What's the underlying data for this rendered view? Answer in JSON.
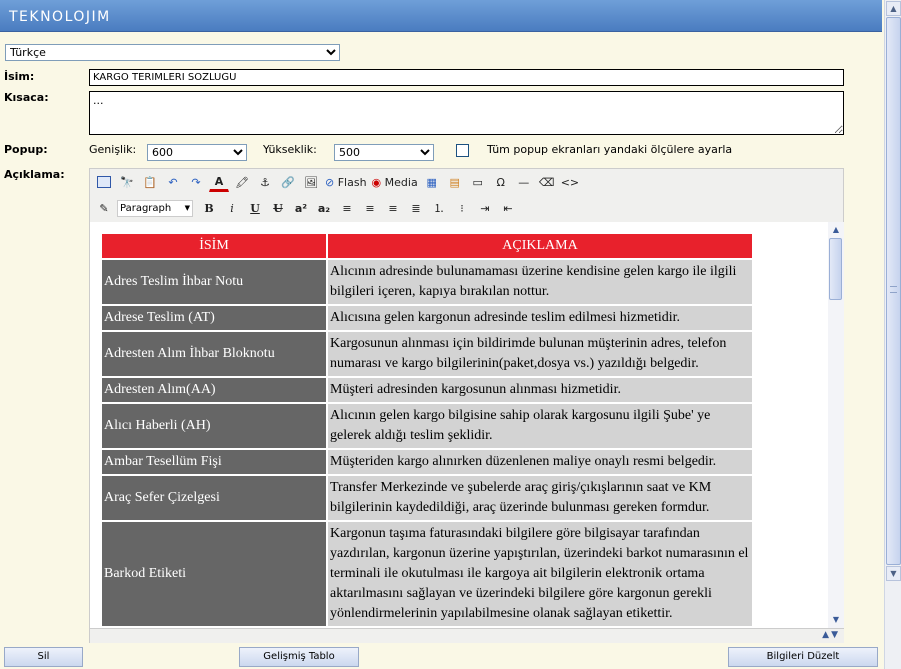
{
  "app": {
    "logo_text": "TEKNOLOJIM"
  },
  "language": {
    "selected": "Türkçe"
  },
  "form": {
    "name_label": "İsim:",
    "name_value": "KARGO TERIMLERİ SÖZLÜĞÜ",
    "summary_label": "Kısaca:",
    "summary_value": "...",
    "popup_label": "Popup:",
    "width_label": "Genişlik:",
    "width_value": "600",
    "height_label": "Yükseklik:",
    "height_value": "500",
    "apply_all_label": "Tüm popup ekranları yandaki ölçülere ayarla",
    "description_label": "Açıklama:"
  },
  "toolbar": {
    "flash_label": "Flash",
    "media_label": "Media",
    "format_value": "Paragraph",
    "bold": "B",
    "italic": "i",
    "underline": "U",
    "strike": "U"
  },
  "table": {
    "header_name": "İSİM",
    "header_desc": "AÇIKLAMA",
    "rows": [
      {
        "name": "Adres Teslim İhbar Notu",
        "desc": "Alıcının adresinde bulunamaması üzerine kendisine gelen kargo ile ilgili bilgileri içeren, kapıya bırakılan nottur."
      },
      {
        "name": "Adrese Teslim (AT)",
        "desc": "Alıcısına gelen kargonun adresinde teslim edilmesi hizmetidir."
      },
      {
        "name": "Adresten Alım İhbar Bloknotu",
        "desc": "Kargosunun alınması için bildirimde bulunan müşterinin adres, telefon numarası ve kargo bilgilerinin(paket,dosya vs.) yazıldığı belgedir."
      },
      {
        "name": "Adresten Alım(AA)",
        "desc": "Müşteri adresinden kargosunun alınması hizmetidir."
      },
      {
        "name": "Alıcı Haberli (AH)",
        "desc": "Alıcının gelen kargo bilgisine sahip olarak kargosunu ilgili Şube' ye gelerek aldığı teslim şeklidir."
      },
      {
        "name": "Ambar Tesellüm Fişi",
        "desc": "Müşteriden kargo alınırken düzenlenen maliye onaylı resmi belgedir."
      },
      {
        "name": "Araç Sefer Çizelgesi",
        "desc": "Transfer Merkezinde ve şubelerde araç giriş/çıkışlarının saat ve KM bilgilerinin kaydedildiği, araç üzerinde bulunması gereken formdur."
      },
      {
        "name": "Barkod Etiketi",
        "desc": "Kargonun taşıma faturasındaki bilgilere göre bilgisayar tarafından yazdırılan, kargonun üzerine yapıştırılan, üzerindeki barkot numarasının el terminali ile okutulması ile kargoya ait bilgilerin elektronik ortama aktarılmasını sağlayan  ve üzerindeki bilgilere göre kargonun gerekli yönlendirmelerinin yapılabilmesine olanak sağlayan etikettir."
      }
    ]
  },
  "buttons": {
    "delete": "Sil",
    "advanced_table": "Gelişmiş Tablo",
    "update": "Bilgileri Düzelt"
  },
  "colors": {
    "header_blue": "#5b8ccb",
    "table_red": "#e8212c",
    "name_gray": "#666666",
    "desc_gray": "#d3d3d3"
  }
}
